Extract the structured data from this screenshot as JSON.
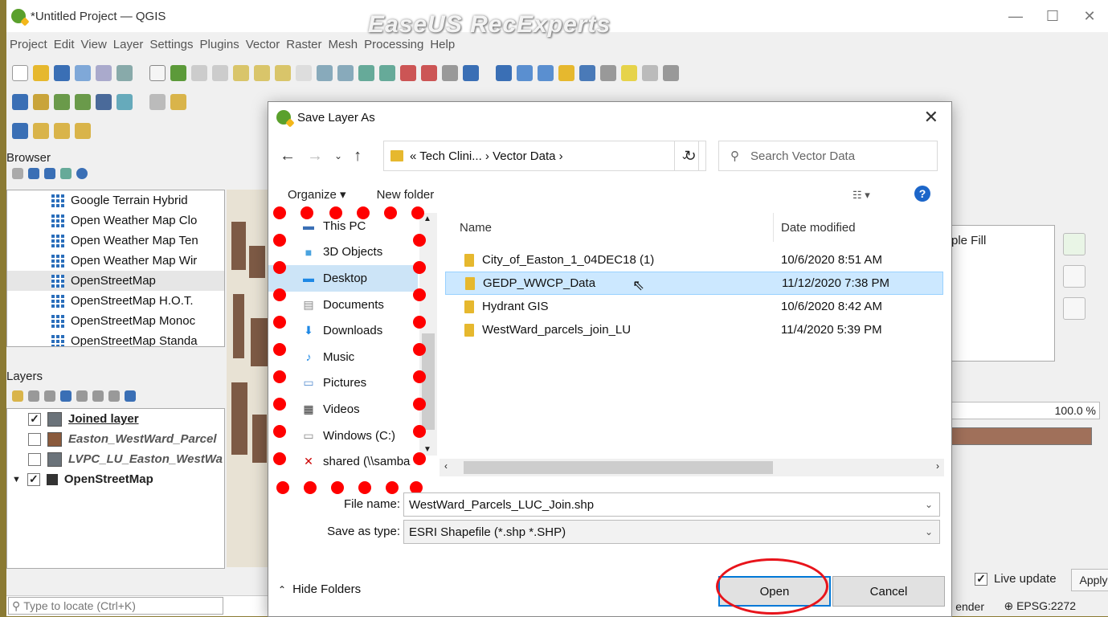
{
  "window": {
    "title": "*Untitled Project — QGIS",
    "watermark": "EaseUS RecExperts",
    "controls": [
      "—",
      "☐",
      "✕"
    ]
  },
  "menu": [
    "Project",
    "Edit",
    "View",
    "Layer",
    "Settings",
    "Plugins",
    "Vector",
    "Raster",
    "Mesh",
    "Processing",
    "Help"
  ],
  "browser": {
    "title": "Browser",
    "items": [
      "Google Terrain Hybrid",
      "Open Weather Map Clo",
      "Open Weather Map Ten",
      "Open Weather Map Wir",
      "OpenStreetMap",
      "OpenStreetMap H.O.T.",
      "OpenStreetMap Monoc",
      "OpenStreetMap Standa"
    ],
    "selected_index": 4
  },
  "layers": {
    "title": "Layers",
    "items": [
      {
        "name": "Joined layer",
        "checked": true,
        "color": "#6b737a",
        "style": "bold-underline"
      },
      {
        "name": "Easton_WestWard_Parcel",
        "checked": false,
        "color": "#8a5a3c",
        "style": "italic"
      },
      {
        "name": "LVPC_LU_Easton_WestWa",
        "checked": false,
        "color": "#6b737a",
        "style": "italic"
      },
      {
        "name": "OpenStreetMap",
        "checked": true,
        "color": "#333333",
        "style": "bold"
      }
    ]
  },
  "statusbar": {
    "locate_placeholder": "Type to locate (Ctrl+K)",
    "render": "ender",
    "epsg": "EPSG:2272"
  },
  "right_panel": {
    "fill_label": "ple Fill",
    "opacity": "100.0 %",
    "live_update": "Live update",
    "apply": "Apply"
  },
  "dialog": {
    "title": "Save Layer As",
    "address": "« Tech Clini... › Vector Data ›",
    "search_placeholder": "Search Vector Data",
    "organize": "Organize ▾",
    "new_folder": "New folder",
    "nav_items": [
      "This PC",
      "3D Objects",
      "Desktop",
      "Documents",
      "Downloads",
      "Music",
      "Pictures",
      "Videos",
      "Windows (C:)",
      "shared (\\\\samba"
    ],
    "nav_selected": "Desktop",
    "columns": {
      "name": "Name",
      "date": "Date modified"
    },
    "files": [
      {
        "name": "City_of_Easton_1_04DEC18 (1)",
        "date": "10/6/2020 8:51 AM"
      },
      {
        "name": "GEDP_WWCP_Data",
        "date": "11/12/2020 7:38 PM"
      },
      {
        "name": "Hydrant GIS",
        "date": "10/6/2020 8:42 AM"
      },
      {
        "name": "WestWard_parcels_join_LU",
        "date": "11/4/2020 5:39 PM"
      }
    ],
    "selected_file": "GEDP_WWCP_Data",
    "file_name_label": "File name:",
    "file_name_value": "WestWard_Parcels_LUC_Join.shp",
    "save_type_label": "Save as type:",
    "save_type_value": "ESRI Shapefile (*.shp *.SHP)",
    "hide_folders": "Hide Folders",
    "open_button": "Open",
    "cancel_button": "Cancel"
  }
}
